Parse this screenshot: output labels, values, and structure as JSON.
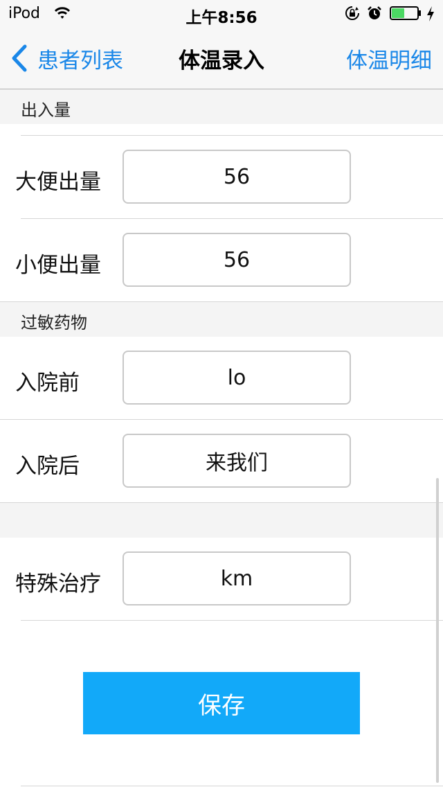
{
  "status_bar": {
    "carrier": "iPod",
    "time": "上午8:56",
    "battery_color": "#4cd964"
  },
  "nav": {
    "back_label": "患者列表",
    "title": "体温录入",
    "right_label": "体温明细",
    "accent_color": "#1a87e8"
  },
  "sections": {
    "output": "出入量",
    "allergy": "过敏药物"
  },
  "rows": {
    "stool": {
      "label": "大便出量",
      "value": "56"
    },
    "urine": {
      "label": "小便出量",
      "value": "56"
    },
    "before_admission": {
      "label": "入院前",
      "value": "lo"
    },
    "after_admission": {
      "label": "入院后",
      "value": "来我们"
    },
    "special_treatment": {
      "label": "特殊治疗",
      "value": "km"
    }
  },
  "save_button": {
    "label": "保存",
    "color": "#12a9f9"
  }
}
